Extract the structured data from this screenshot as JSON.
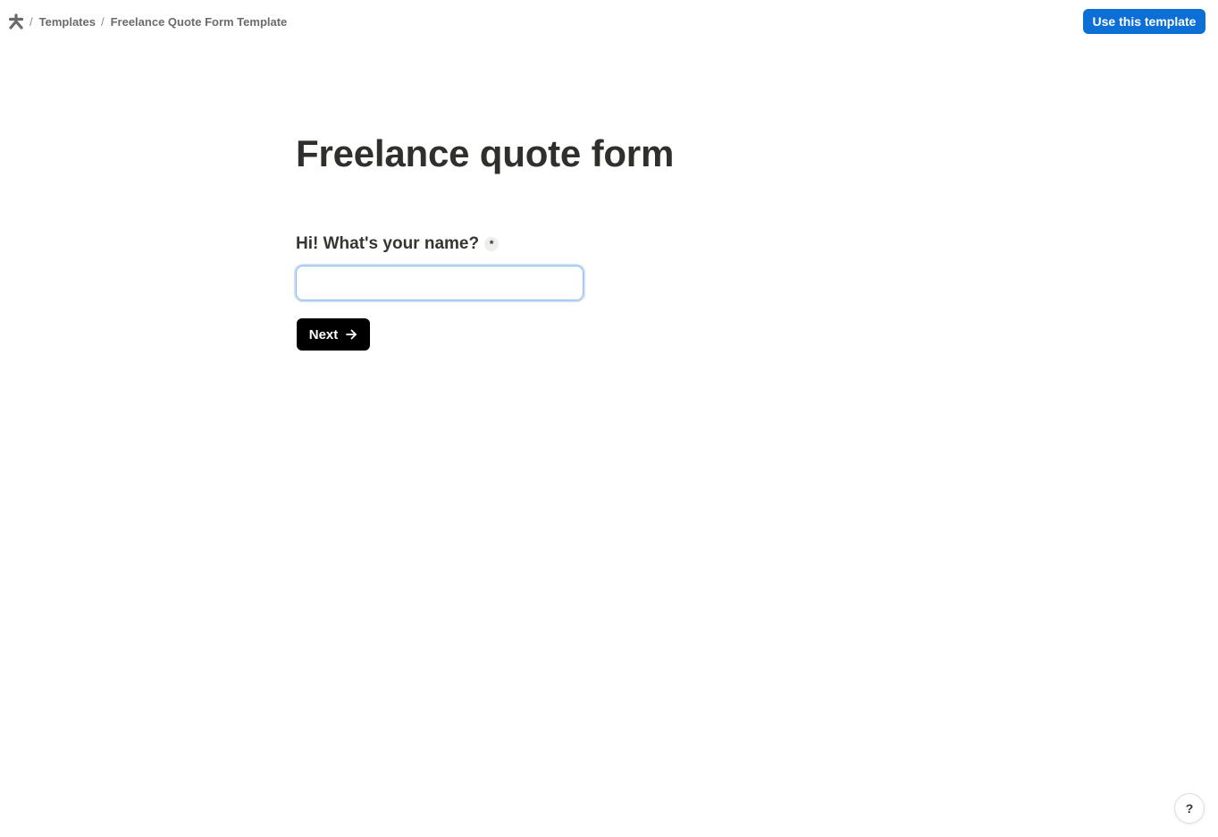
{
  "header": {
    "logo_icon": "asterisk-logo-icon",
    "breadcrumb": {
      "separator": "/",
      "items": [
        {
          "label": "Templates"
        },
        {
          "label": "Freelance Quote Form Template"
        }
      ]
    },
    "use_template_label": "Use this template"
  },
  "form": {
    "title": "Freelance quote form",
    "question": {
      "label": "Hi! What's your name?",
      "required_marker": "*",
      "value": "",
      "placeholder": ""
    },
    "next_button": {
      "label": "Next",
      "icon": "arrow-right-icon"
    }
  },
  "help": {
    "label": "?"
  },
  "colors": {
    "accent": "#0b6fd6",
    "primary_button": "#000000",
    "text": "#37352f",
    "muted_text": "#6b6b6b",
    "input_focus_border": "#8cb8ea"
  }
}
